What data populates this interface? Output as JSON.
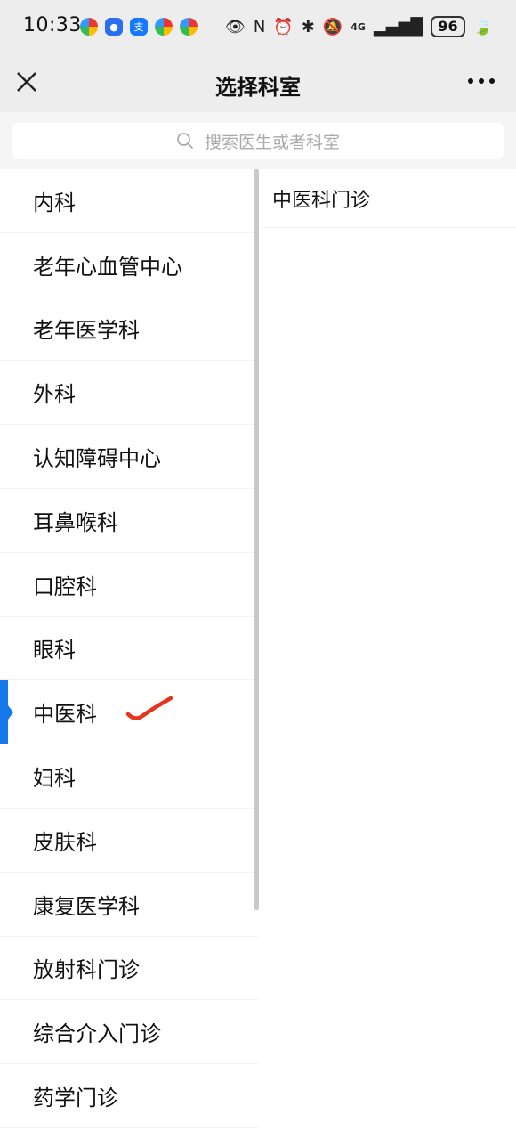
{
  "status_bar": {
    "time": "10:33",
    "network": "4G",
    "battery": "96",
    "app_icons": [
      "app-icon-1",
      "app-icon-2",
      "alipay-icon",
      "app-icon-3",
      "app-icon-4"
    ]
  },
  "nav": {
    "title": "选择科室",
    "close_icon": "close-icon",
    "more_icon": "more-icon"
  },
  "search": {
    "placeholder": "搜索医生或者科室"
  },
  "departments": [
    "内科",
    "老年心血管中心",
    "老年医学科",
    "外科",
    "认知障碍中心",
    "耳鼻喉科",
    "口腔科",
    "眼科",
    "中医科",
    "妇科",
    "皮肤科",
    "康复医学科",
    "放射科门诊",
    "综合介入门诊",
    "药学门诊"
  ],
  "selected_department": "中医科",
  "sub_departments": [
    "中医科门诊"
  ],
  "colors": {
    "accent": "#1677e8",
    "check_mark": "#e8331f"
  }
}
